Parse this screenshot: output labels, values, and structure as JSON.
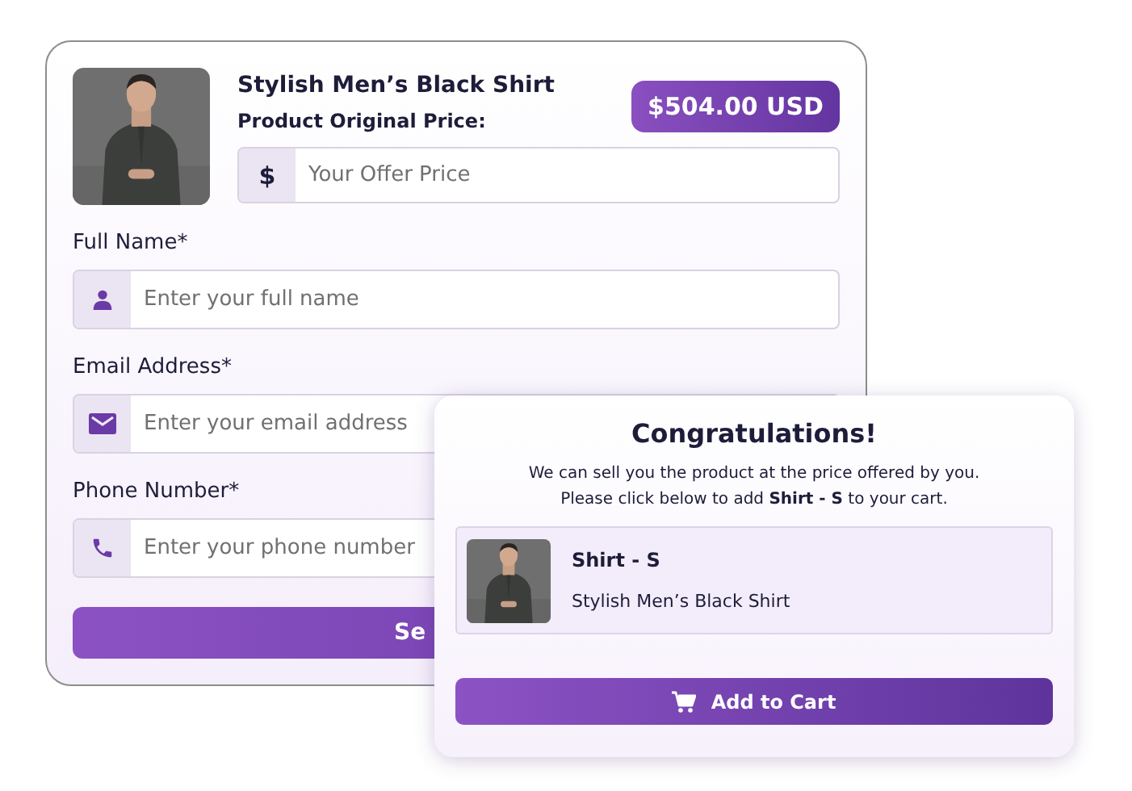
{
  "offer_form": {
    "product_title": "Stylish Men’s Black Shirt",
    "price_label": "Product Original Price:",
    "price": "$504.00 USD",
    "offer_field": {
      "prefix": "$",
      "placeholder": "Your Offer Price"
    },
    "fields": [
      {
        "label": "Full Name*",
        "placeholder": "Enter your full name"
      },
      {
        "label": "Email Address*",
        "placeholder": "Enter your email address"
      },
      {
        "label": "Phone Number*",
        "placeholder": "Enter your phone number"
      }
    ],
    "submit_button": "Se"
  },
  "popup": {
    "title": "Congratulations!",
    "message": [
      "We can sell you the product at the price offered by you.",
      "Please click below to add **Shirt - S** to your cart."
    ],
    "item": {
      "name": "Shirt - S",
      "description": "Stylish Men’s Black Shirt"
    },
    "button": "Add to Cart"
  }
}
